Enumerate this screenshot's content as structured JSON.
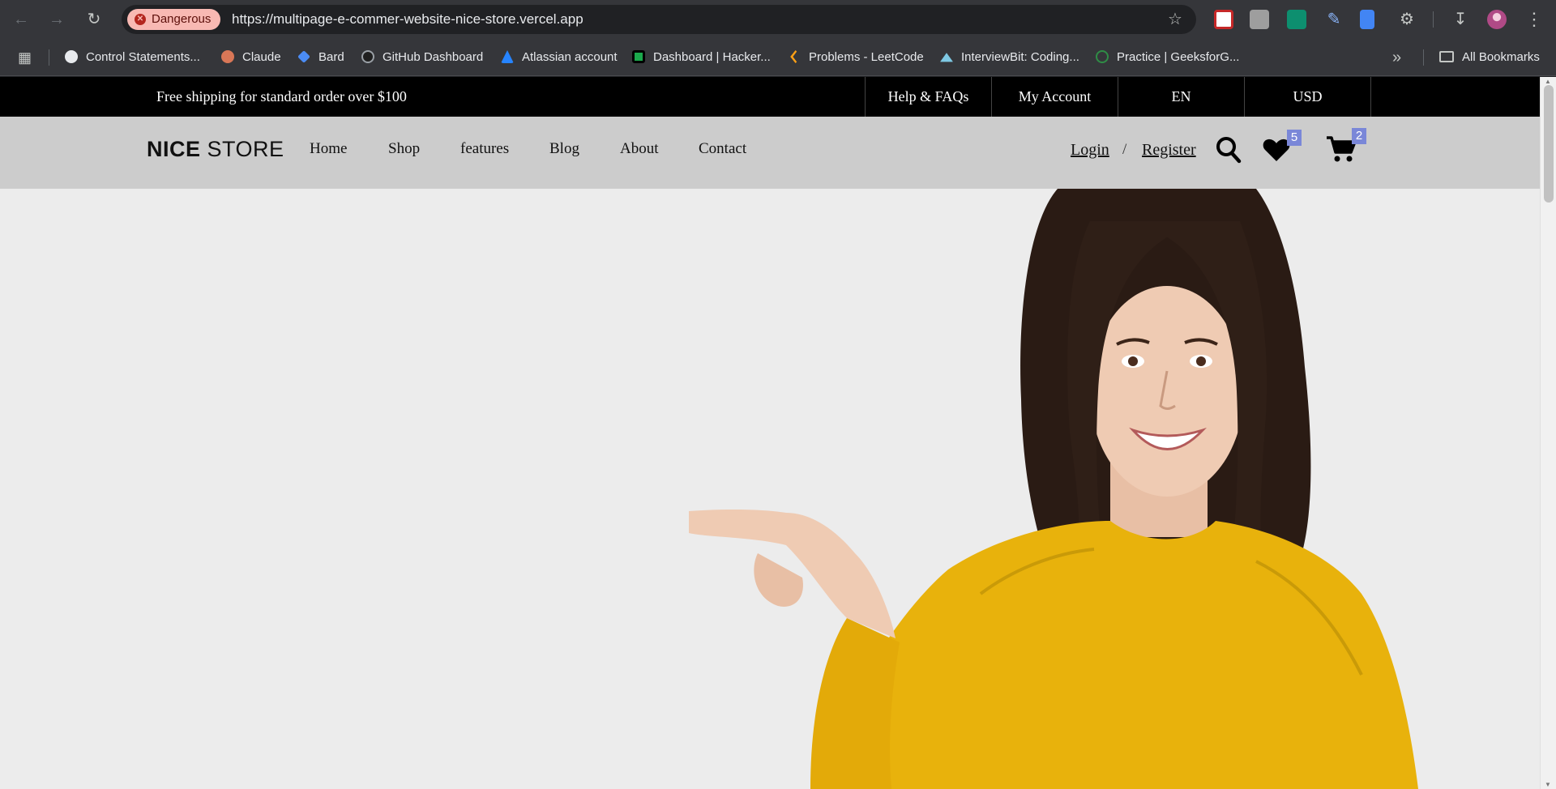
{
  "browser": {
    "security_chip": "Dangerous",
    "url": "https://multipage-e-commer-website-nice-store.vercel.app",
    "bookmarks": [
      {
        "label": "Control Statements..."
      },
      {
        "label": "Claude"
      },
      {
        "label": "Bard"
      },
      {
        "label": "GitHub Dashboard"
      },
      {
        "label": "Atlassian account"
      },
      {
        "label": "Dashboard | Hacker..."
      },
      {
        "label": "Problems - LeetCode"
      },
      {
        "label": "InterviewBit: Coding..."
      },
      {
        "label": "Practice | GeeksforG..."
      }
    ],
    "all_bookmarks": "All Bookmarks"
  },
  "topbar": {
    "shipping_text": "Free shipping for standard order over $100",
    "links": [
      "Help & FAQs",
      "My Account",
      "EN",
      "USD"
    ]
  },
  "header": {
    "logo_bold": "NICE",
    "logo_light": "STORE",
    "nav": [
      "Home",
      "Shop",
      "features",
      "Blog",
      "About",
      "Contact"
    ],
    "login": "Login",
    "separator": "/",
    "register": "Register",
    "wishlist_count": "5",
    "cart_count": "2"
  },
  "colors": {
    "topbar_bg": "#000000",
    "header_bg": "#cccccc",
    "hero_bg": "#ececec",
    "badge_bg": "#7a87d8",
    "danger_chip_bg": "#f8b9b3"
  }
}
